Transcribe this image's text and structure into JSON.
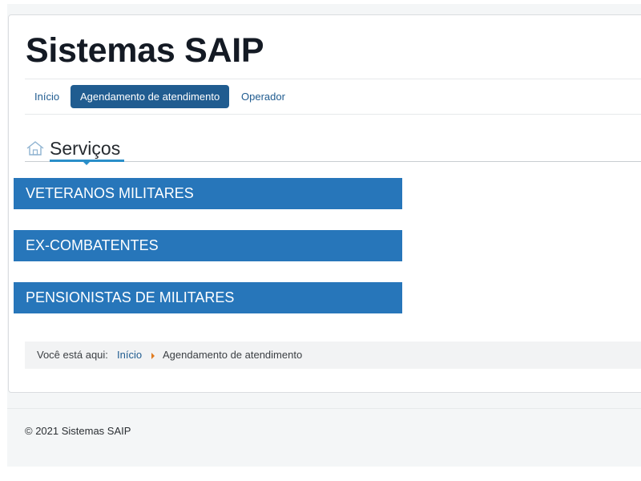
{
  "site": {
    "title": "Sistemas SAIP"
  },
  "nav": {
    "items": [
      {
        "label": "Início",
        "active": false
      },
      {
        "label": "Agendamento de atendimento",
        "active": true
      },
      {
        "label": "Operador",
        "active": false
      }
    ]
  },
  "section": {
    "icon": "home-icon",
    "title": "Serviços"
  },
  "services": [
    {
      "label": "VETERANOS MILITARES"
    },
    {
      "label": "EX-COMBATENTES"
    },
    {
      "label": "PENSIONISTAS DE MILITARES"
    }
  ],
  "breadcrumb": {
    "label": "Você está aqui:",
    "link": "Início",
    "current": "Agendamento de atendimento"
  },
  "footer": {
    "copyright": "© 2021 Sistemas SAIP"
  },
  "colors": {
    "primary": "#205c90",
    "service_button": "#2776ba",
    "accent_underline": "#2a8fc9",
    "breadcrumb_separator": "#e07b1f"
  }
}
